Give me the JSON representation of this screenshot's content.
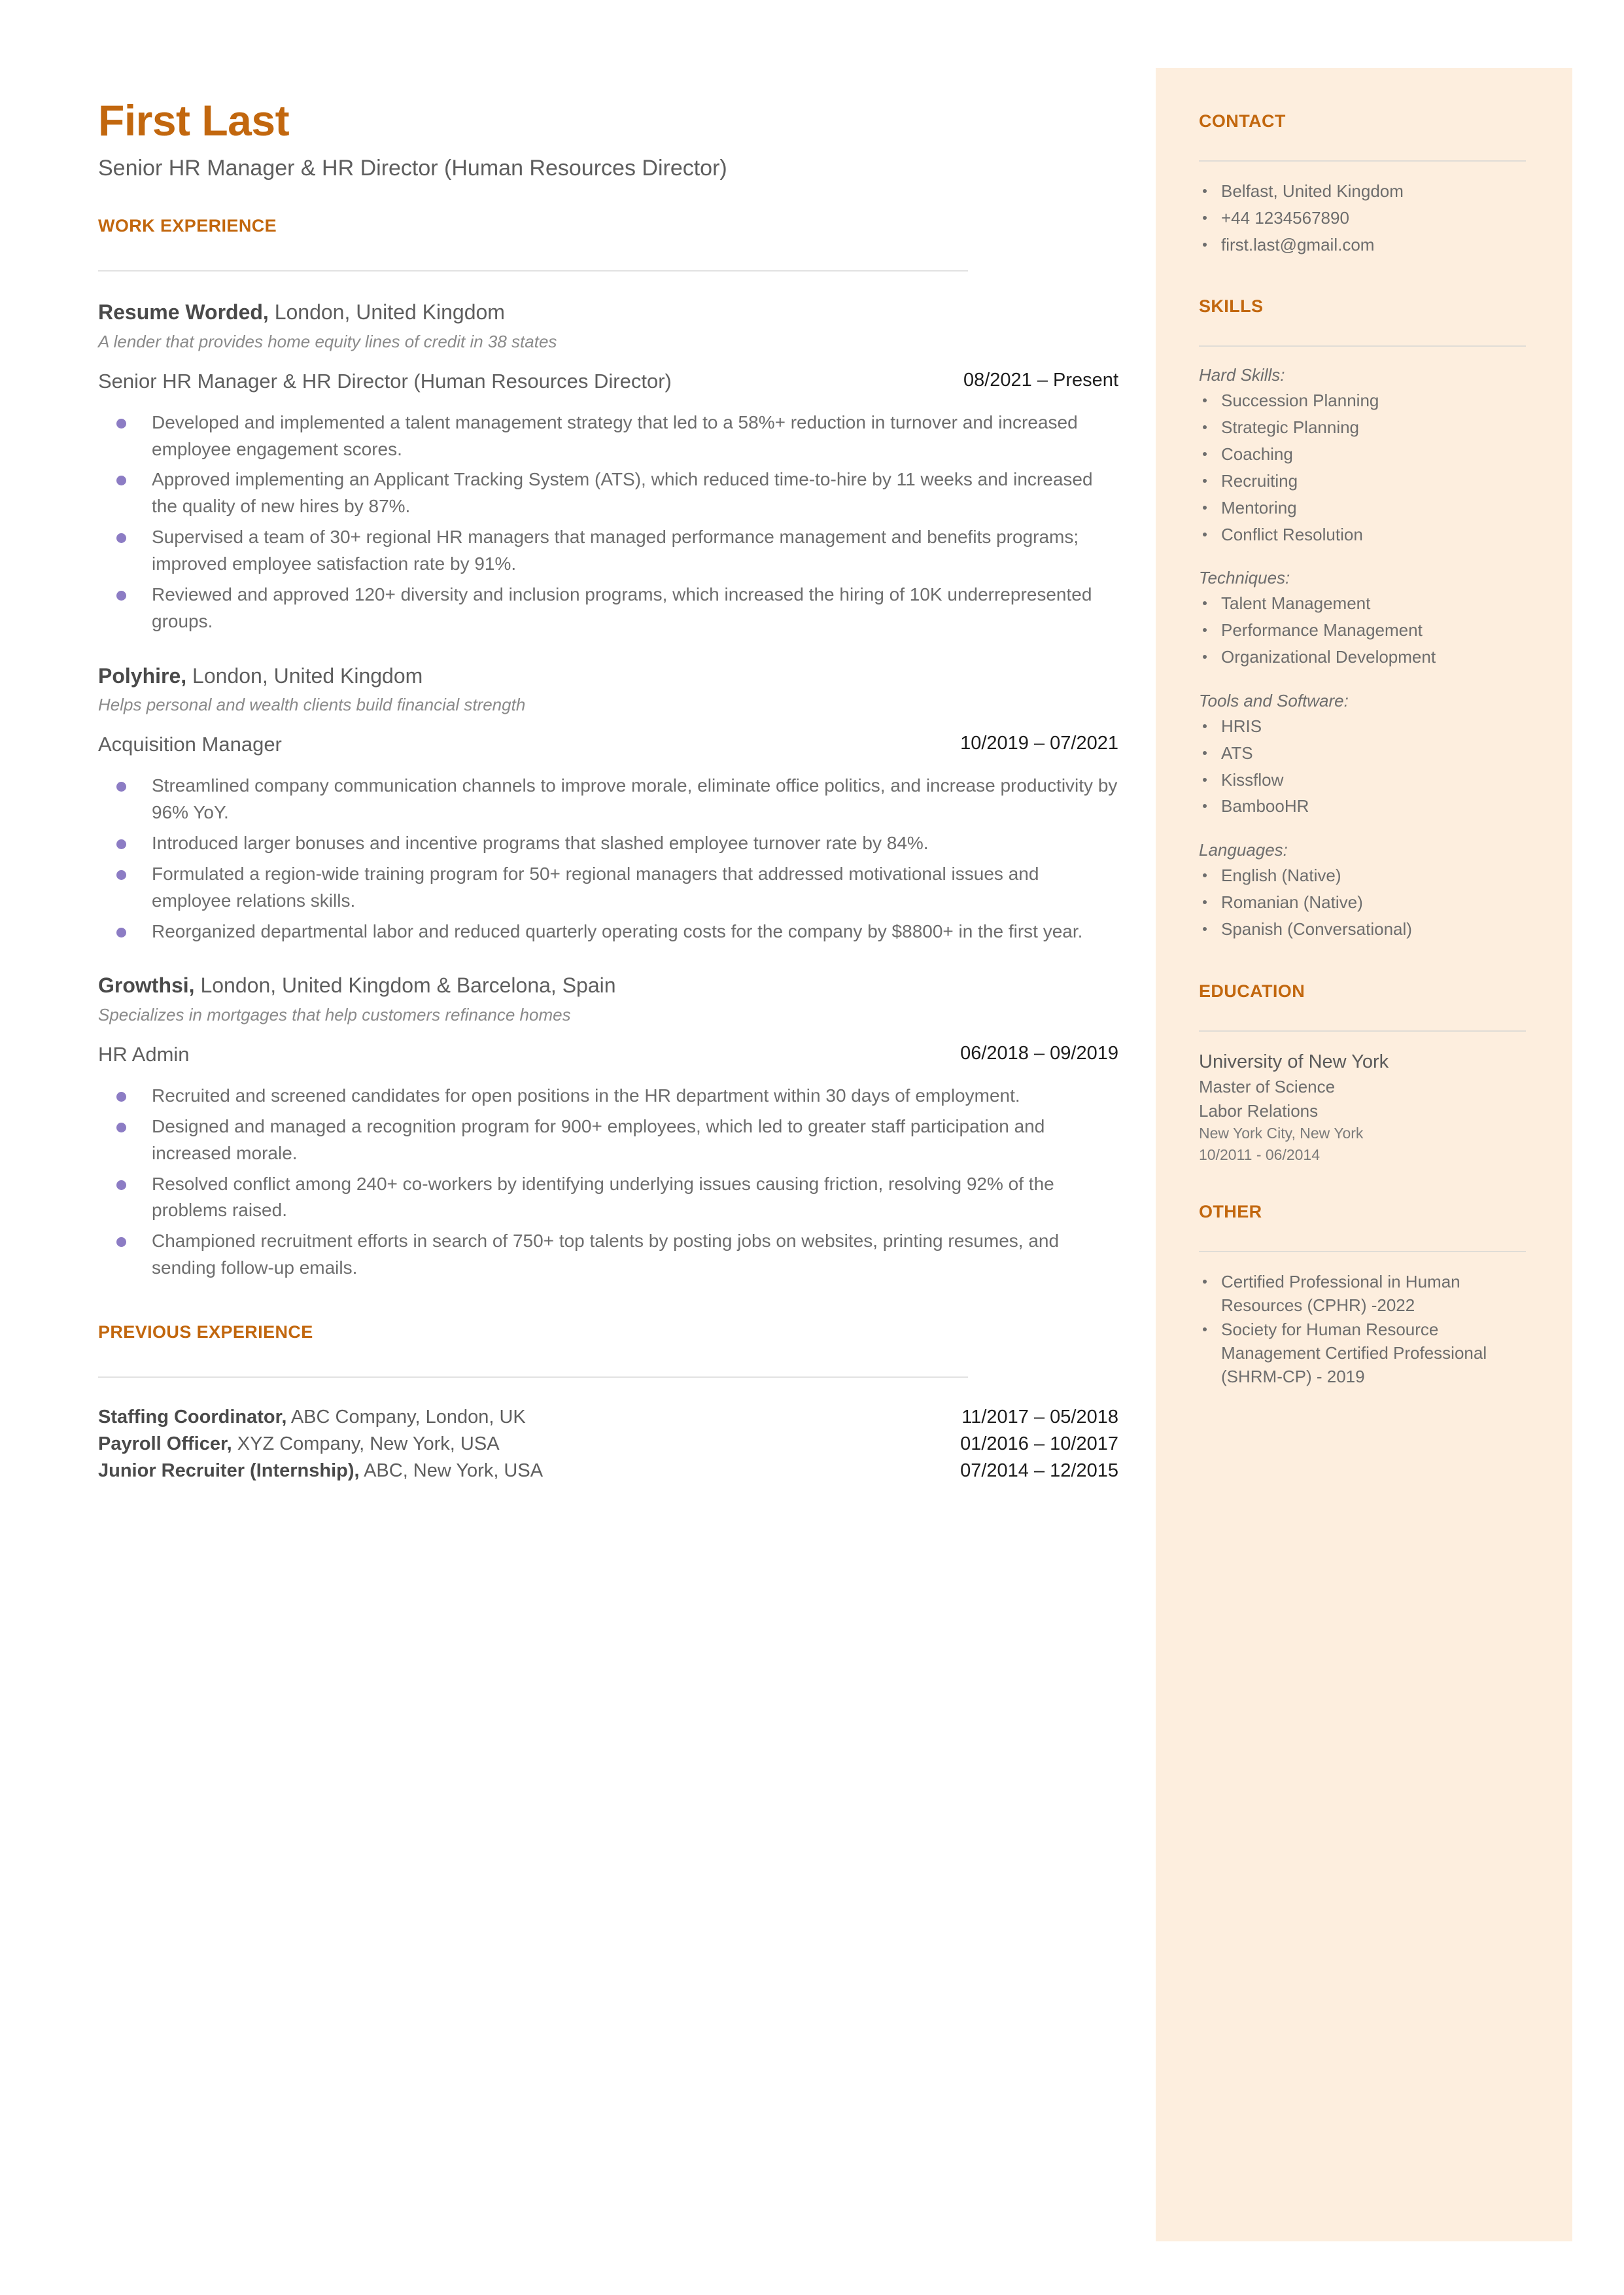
{
  "theme": {
    "accent": "#c2670e",
    "sidebar_bg": "#fdeede",
    "bullet": "#8c7cc4",
    "body_text": "#6d6d6d",
    "date_text": "#1d1d1d"
  },
  "header": {
    "name": "First Last",
    "headline": "Senior HR Manager & HR Director (Human Resources Director)"
  },
  "work_experience": {
    "section_title": "WORK EXPERIENCE",
    "jobs": [
      {
        "company": "Resume Worded,",
        "location": " London, United Kingdom",
        "description": "A lender that provides home equity lines of credit in 38 states",
        "title": "Senior HR Manager & HR Director (Human Resources Director)",
        "dates": "08/2021 – Present",
        "bullets": [
          "Developed and implemented a talent management strategy that led to a 58%+ reduction in turnover and increased employee engagement scores.",
          "Approved implementing an Applicant Tracking System (ATS), which reduced time-to-hire by 11 weeks and increased the quality of new hires by 87%.",
          "Supervised a team of 30+ regional HR managers that managed performance management and benefits programs; improved employee satisfaction rate by 91%.",
          "Reviewed and approved 120+ diversity and inclusion programs, which increased the hiring of 10K underrepresented groups."
        ]
      },
      {
        "company": "Polyhire,",
        "location": " London, United Kingdom",
        "description": "Helps personal and wealth clients build financial strength",
        "title": "Acquisition Manager",
        "dates": "10/2019 – 07/2021",
        "bullets": [
          "Streamlined company communication channels to improve morale, eliminate office politics, and increase productivity by 96% YoY.",
          "Introduced larger bonuses and incentive programs that slashed employee turnover rate by 84%.",
          "Formulated a region-wide training program for 50+ regional managers that addressed motivational issues and employee relations skills.",
          "Reorganized departmental labor and reduced quarterly operating costs for the company by $8800+ in the first year."
        ]
      },
      {
        "company": "Growthsi,",
        "location": " London, United Kingdom & Barcelona, Spain",
        "description": "Specializes in mortgages that help customers refinance homes",
        "title": "HR Admin",
        "dates": "06/2018 – 09/2019",
        "bullets": [
          "Recruited and screened candidates for open positions in the HR department within 30 days of employment.",
          "Designed and managed a recognition program for 900+ employees, which led to greater staff participation and increased morale.",
          "Resolved conflict among 240+ co-workers by identifying underlying issues causing friction, resolving 92% of the problems raised.",
          "Championed recruitment efforts in search of 750+ top talents by posting jobs on websites, printing resumes, and sending follow-up emails."
        ]
      }
    ]
  },
  "previous_experience": {
    "section_title": "PREVIOUS EXPERIENCE",
    "rows": [
      {
        "role_bold": "Staffing Coordinator,",
        "role_rest": " ABC Company, London, UK",
        "dates": "11/2017 – 05/2018"
      },
      {
        "role_bold": "Payroll Officer,",
        "role_rest": " XYZ Company, New York, USA",
        "dates": "01/2016 – 10/2017"
      },
      {
        "role_bold": "Junior Recruiter (Internship),",
        "role_rest": " ABC, New York, USA",
        "dates": "07/2014 – 12/2015"
      }
    ]
  },
  "sidebar": {
    "contact": {
      "title": "CONTACT",
      "items": [
        "Belfast, United Kingdom",
        "+44 1234567890",
        "first.last@gmail.com"
      ]
    },
    "skills": {
      "title": "SKILLS",
      "groups": [
        {
          "label": "Hard Skills:",
          "items": [
            "Succession Planning",
            "Strategic Planning",
            "Coaching",
            "Recruiting",
            "Mentoring",
            "Conflict Resolution"
          ]
        },
        {
          "label": "Techniques:",
          "items": [
            "Talent Management",
            "Performance Management",
            "Organizational Development"
          ]
        },
        {
          "label": "Tools and Software:",
          "items": [
            "HRIS",
            "ATS",
            "Kissflow",
            "BambooHR"
          ]
        },
        {
          "label": "Languages:",
          "items": [
            "English (Native)",
            "Romanian (Native)",
            "Spanish (Conversational)"
          ]
        }
      ]
    },
    "education": {
      "title": "EDUCATION",
      "school": "University of New York",
      "degree": "Master of Science",
      "field": "Labor Relations",
      "location": "New York City, New York",
      "dates": "10/2011 - 06/2014"
    },
    "other": {
      "title": "OTHER",
      "items": [
        "Certified Professional in Human Resources (CPHR) -2022",
        "Society for Human Resource Management Certified Professional (SHRM-CP) - 2019"
      ]
    }
  }
}
